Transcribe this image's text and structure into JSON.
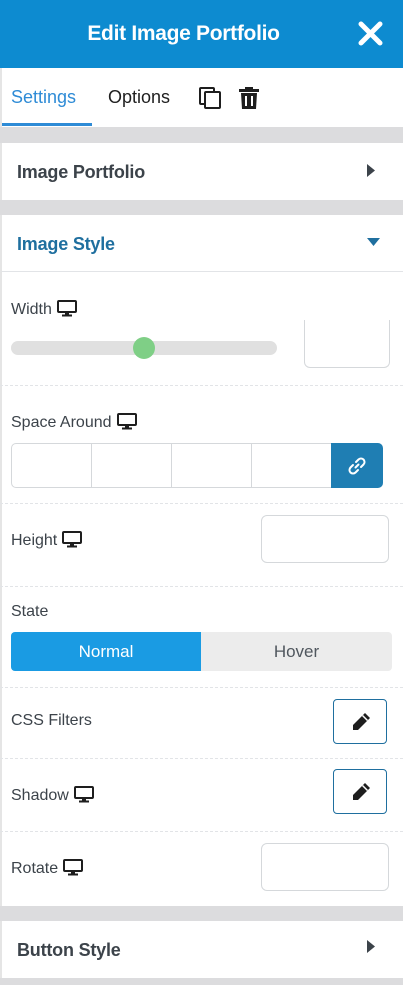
{
  "header": {
    "title": "Edit Image Portfolio",
    "close_icon": "close-icon"
  },
  "tabs": {
    "settings": "Settings",
    "options": "Options",
    "duplicate_icon": "duplicate-icon",
    "delete_icon": "trash-icon"
  },
  "panels": {
    "image_portfolio": {
      "label": "Image Portfolio",
      "expanded": false
    },
    "image_style": {
      "label": "Image Style",
      "expanded": true
    },
    "button_style": {
      "label": "Button Style",
      "expanded": false
    }
  },
  "controls": {
    "width": {
      "label": "Width",
      "slider_value_fraction": 0.5,
      "value": ""
    },
    "space_around": {
      "label": "Space Around",
      "values": [
        "",
        "",
        "",
        ""
      ],
      "linked": true
    },
    "height": {
      "label": "Height",
      "value": ""
    },
    "state": {
      "label": "State",
      "options": [
        "Normal",
        "Hover"
      ],
      "selected": "Normal"
    },
    "css_filters": {
      "label": "CSS Filters"
    },
    "shadow": {
      "label": "Shadow"
    },
    "rotate": {
      "label": "Rotate",
      "value": ""
    }
  },
  "colors": {
    "header_bg": "#0d8bd0",
    "accent": "#2e8bd6",
    "link_button": "#1f7eb3",
    "slider_knob": "#7fcf86",
    "state_active": "#1a9be3"
  }
}
